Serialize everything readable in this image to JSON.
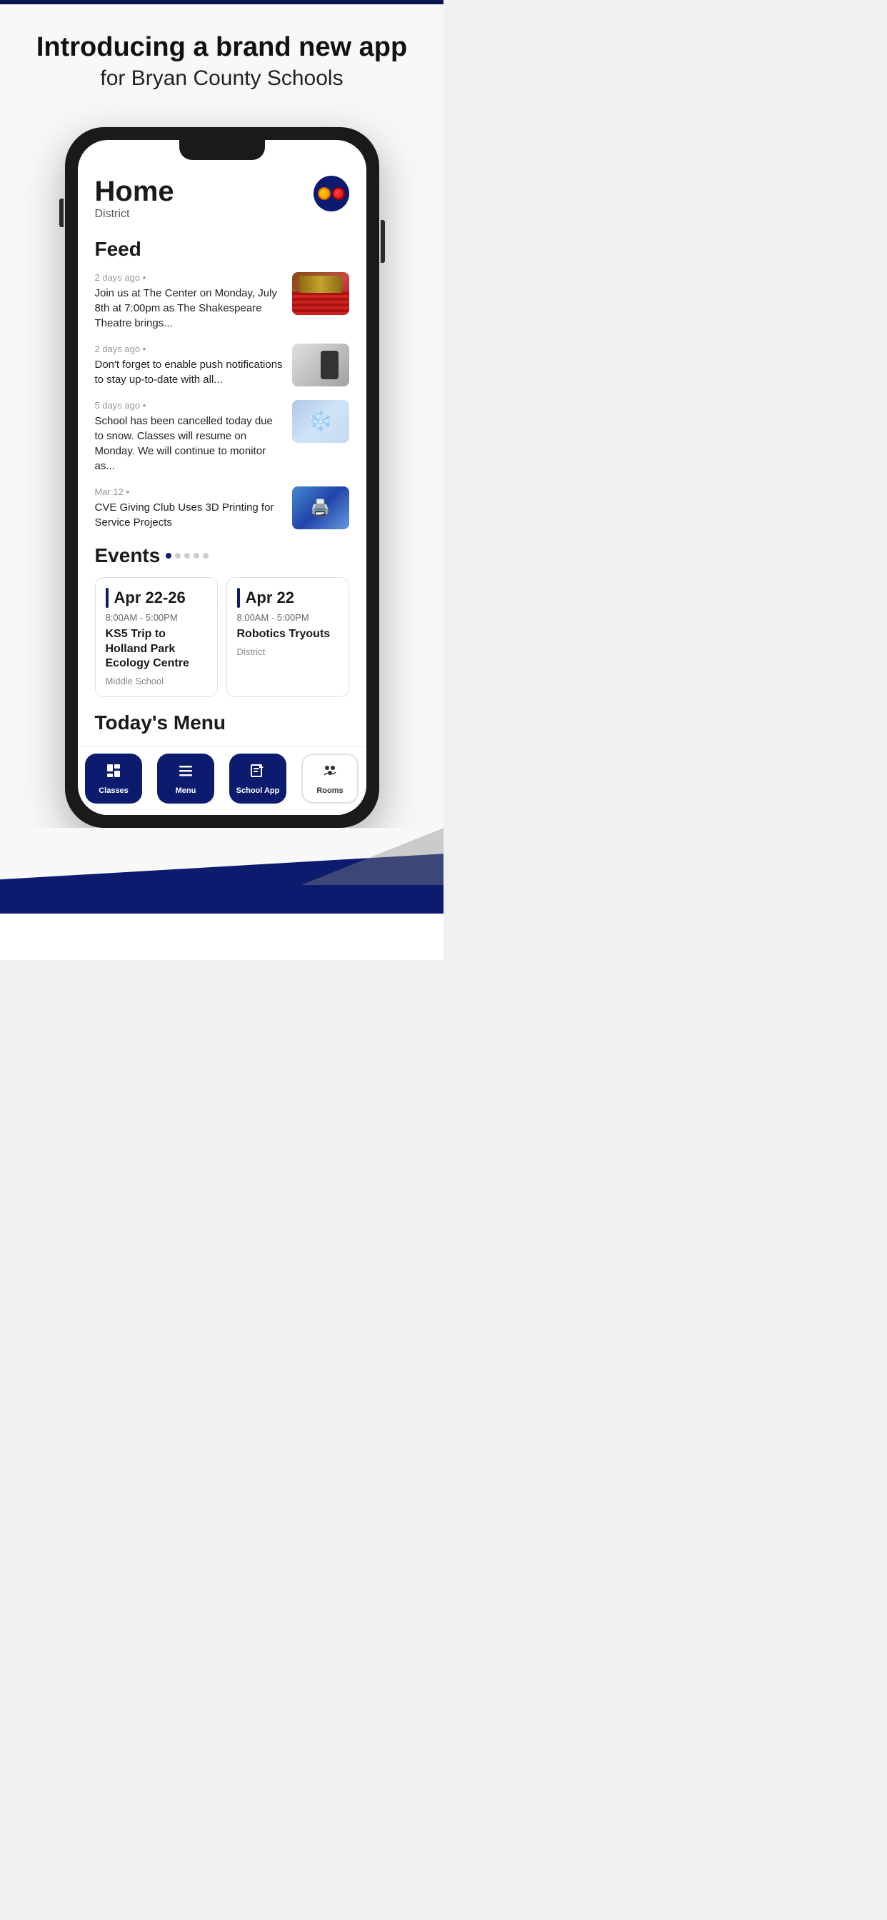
{
  "page": {
    "top_bar_color": "#0a1650",
    "background_color": "#f8f8f8"
  },
  "header": {
    "headline": "Introducing a brand new app",
    "subheadline": "for Bryan County Schools"
  },
  "phone": {
    "screen": {
      "home": {
        "title": "Home",
        "subtitle": "District"
      },
      "feed": {
        "section_title": "Feed",
        "items": [
          {
            "timestamp": "2 days ago",
            "bullet": "•",
            "text": "Join us at The Center on Monday, July 8th at 7:00pm as The Shakespeare Theatre brings...",
            "image_type": "theater"
          },
          {
            "timestamp": "2 days ago",
            "bullet": "•",
            "text": "Don't forget to enable push notifications to stay up-to-date with all...",
            "image_type": "phone"
          },
          {
            "timestamp": "5 days ago",
            "bullet": "•",
            "text": "School has been cancelled today due to snow. Classes will resume on Monday. We will continue to monitor as...",
            "image_type": "snow"
          },
          {
            "timestamp": "Mar 12",
            "bullet": "•",
            "text": "CVE Giving Club Uses 3D Printing for Service Projects",
            "image_type": "3d"
          }
        ]
      },
      "events": {
        "section_title": "Events",
        "cards": [
          {
            "date": "Apr 22-26",
            "time": "8:00AM  -  5:00PM",
            "name": "KS5 Trip to Holland Park Ecology Centre",
            "location": "Middle School"
          },
          {
            "date": "Apr 22",
            "time": "8:00AM  -  5:00PM",
            "name": "Robotics Tryouts",
            "location": "District"
          }
        ]
      },
      "todays_menu": {
        "section_title": "Today's Menu"
      },
      "bottom_nav": {
        "items": [
          {
            "icon": "📋",
            "label": "Classes",
            "filled": true
          },
          {
            "icon": "☰",
            "label": "Menu",
            "filled": true
          },
          {
            "icon": "🏫",
            "label": "School App",
            "filled": true
          },
          {
            "icon": "👥",
            "label": "Rooms",
            "filled": false,
            "outline": true
          }
        ]
      }
    }
  }
}
